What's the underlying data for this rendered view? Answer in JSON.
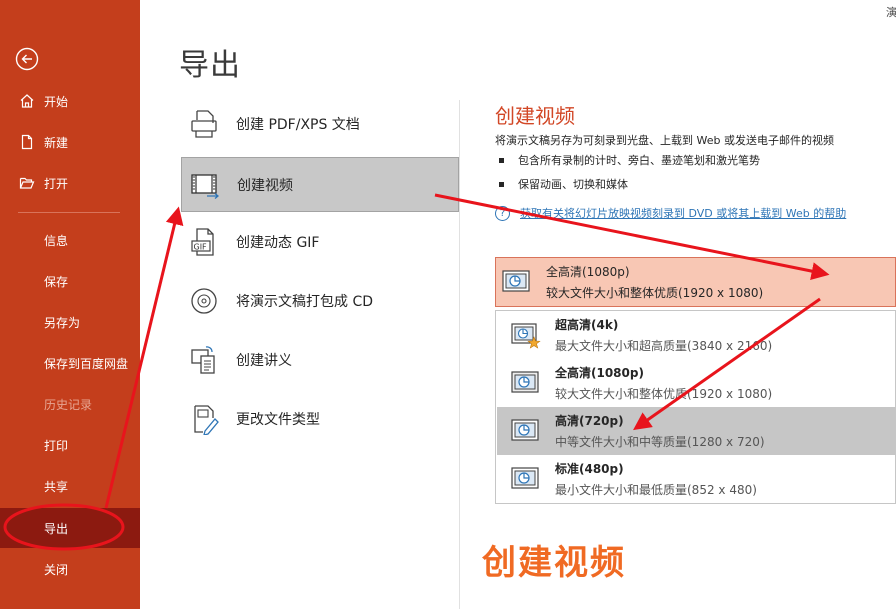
{
  "sidebar": {
    "items": [
      {
        "label": "开始",
        "icon": "home-icon"
      },
      {
        "label": "新建",
        "icon": "new-file-icon"
      },
      {
        "label": "打开",
        "icon": "folder-open-icon"
      },
      {
        "label": "信息"
      },
      {
        "label": "保存"
      },
      {
        "label": "另存为"
      },
      {
        "label": "保存到百度网盘"
      },
      {
        "label": "历史记录",
        "state": "disabled"
      },
      {
        "label": "打印"
      },
      {
        "label": "共享"
      },
      {
        "label": "导出",
        "state": "active"
      },
      {
        "label": "关闭"
      }
    ]
  },
  "page": {
    "title": "导出",
    "corner_text": "演"
  },
  "export_options": [
    {
      "label": "创建 PDF/XPS 文档",
      "icon": "pdf-document-icon"
    },
    {
      "label": "创建视频",
      "icon": "video-film-icon",
      "selected": true
    },
    {
      "label": "创建动态 GIF",
      "icon": "gif-file-icon"
    },
    {
      "label": "将演示文稿打包成 CD",
      "icon": "cd-disc-icon"
    },
    {
      "label": "创建讲义",
      "icon": "handout-icon"
    },
    {
      "label": "更改文件类型",
      "icon": "change-file-type-icon"
    }
  ],
  "detail": {
    "title": "创建视频",
    "description": "将演示文稿另存为可刻录到光盘、上载到 Web 或发送电子邮件的视频",
    "bullets": [
      "包含所有录制的计时、旁白、墨迹笔划和激光笔势",
      "保留动画、切换和媒体"
    ],
    "help_link": "获取有关将幻灯片放映视频刻录到 DVD 或将其上载到 Web 的帮助"
  },
  "quality": {
    "selected": {
      "name": "全高清(1080p)",
      "desc": "较大文件大小和整体优质(1920 x 1080)"
    },
    "options": [
      {
        "name": "超高清(4k)",
        "desc": "最大文件大小和超高质量(3840 x 2160)"
      },
      {
        "name": "全高清(1080p)",
        "desc": "较大文件大小和整体优质(1920 x 1080)"
      },
      {
        "name": "高清(720p)",
        "desc": "中等文件大小和中等质量(1280 x 720)",
        "state": "hover"
      },
      {
        "name": "标准(480p)",
        "desc": "最小文件大小和最低质量(852 x 480)"
      }
    ]
  },
  "caption": "创建视频",
  "colors": {
    "sidebar_bg": "#c43e1c",
    "sidebar_active": "#8c1a10",
    "accent": "#d24726",
    "annotation": "#e8141c",
    "caption": "#f06a23",
    "link": "#2e75b6"
  }
}
